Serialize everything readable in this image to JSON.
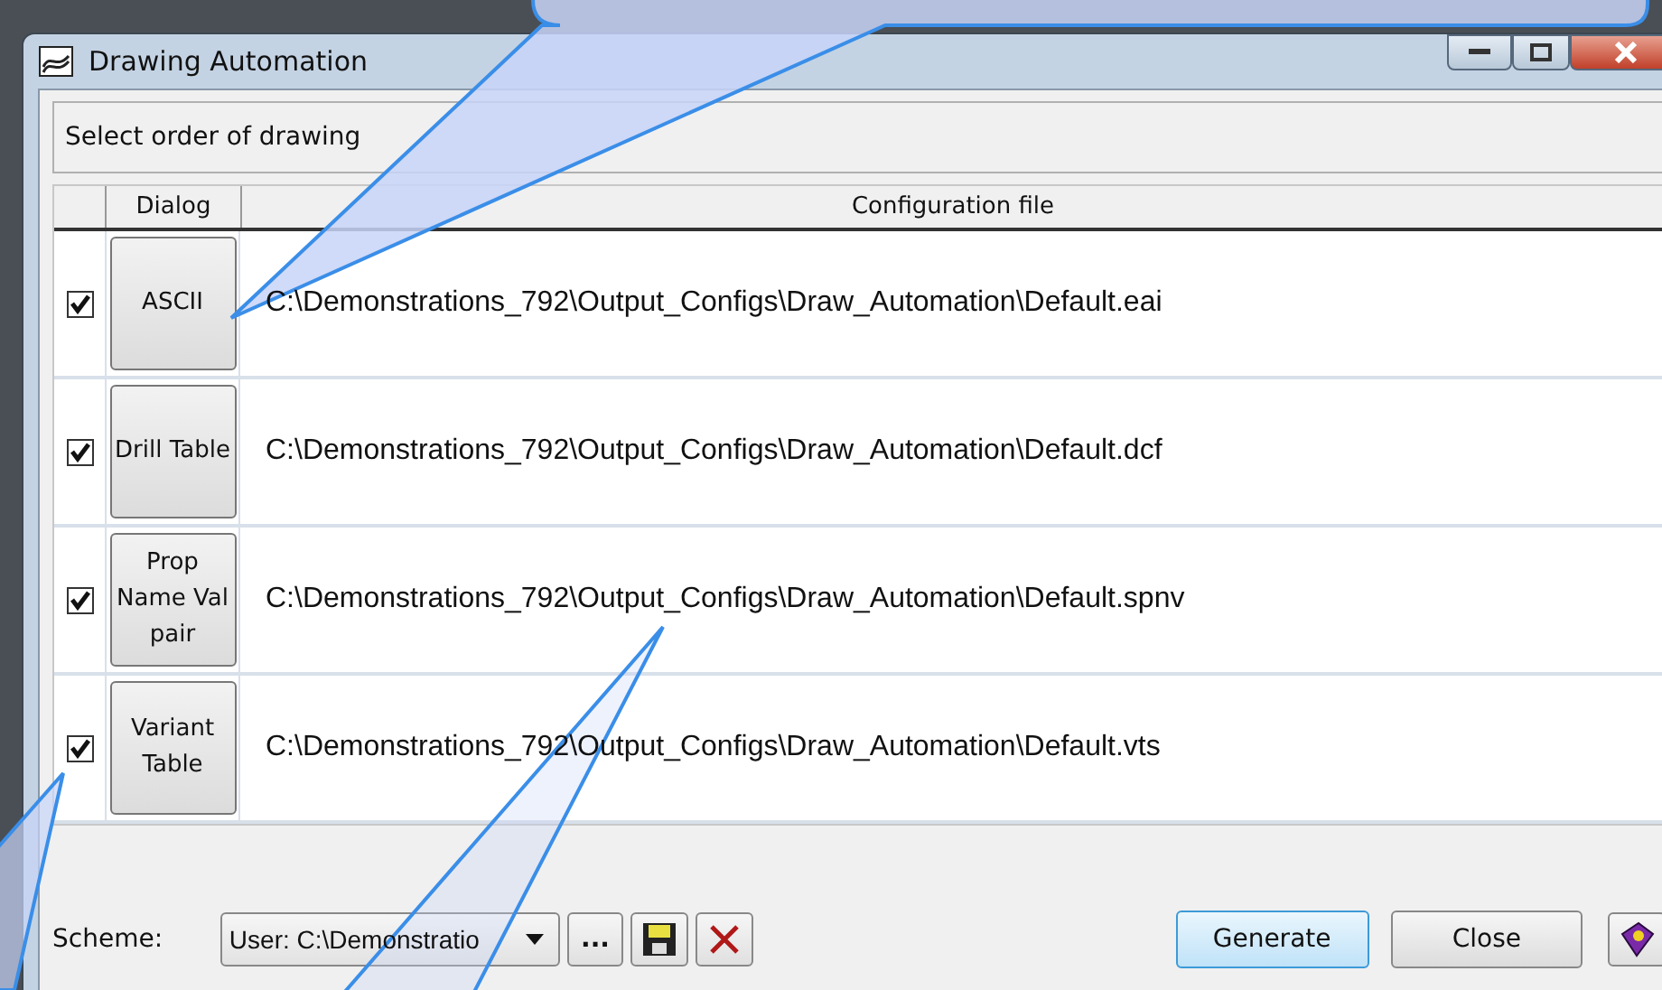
{
  "window": {
    "title": "Drawing Automation"
  },
  "instruction": "Select order of drawing",
  "table": {
    "columns": [
      "Dialog",
      "Configuration file"
    ],
    "rows": [
      {
        "checked": true,
        "dialog": "ASCII",
        "config": "C:\\Demonstrations_792\\Output_Configs\\Draw_Automation\\Default.eai"
      },
      {
        "checked": true,
        "dialog": "Drill Table",
        "config": "C:\\Demonstrations_792\\Output_Configs\\Draw_Automation\\Default.dcf"
      },
      {
        "checked": true,
        "dialog": "Prop Name Val pair",
        "config": "C:\\Demonstrations_792\\Output_Configs\\Draw_Automation\\Default.spnv"
      },
      {
        "checked": true,
        "dialog": "Variant Table",
        "config": "C:\\Demonstrations_792\\Output_Configs\\Draw_Automation\\Default.vts"
      }
    ]
  },
  "scheme": {
    "label": "Scheme:",
    "value": "User: C:\\Demonstratio",
    "browse": "..."
  },
  "buttons": {
    "generate": "Generate",
    "close": "Close"
  }
}
